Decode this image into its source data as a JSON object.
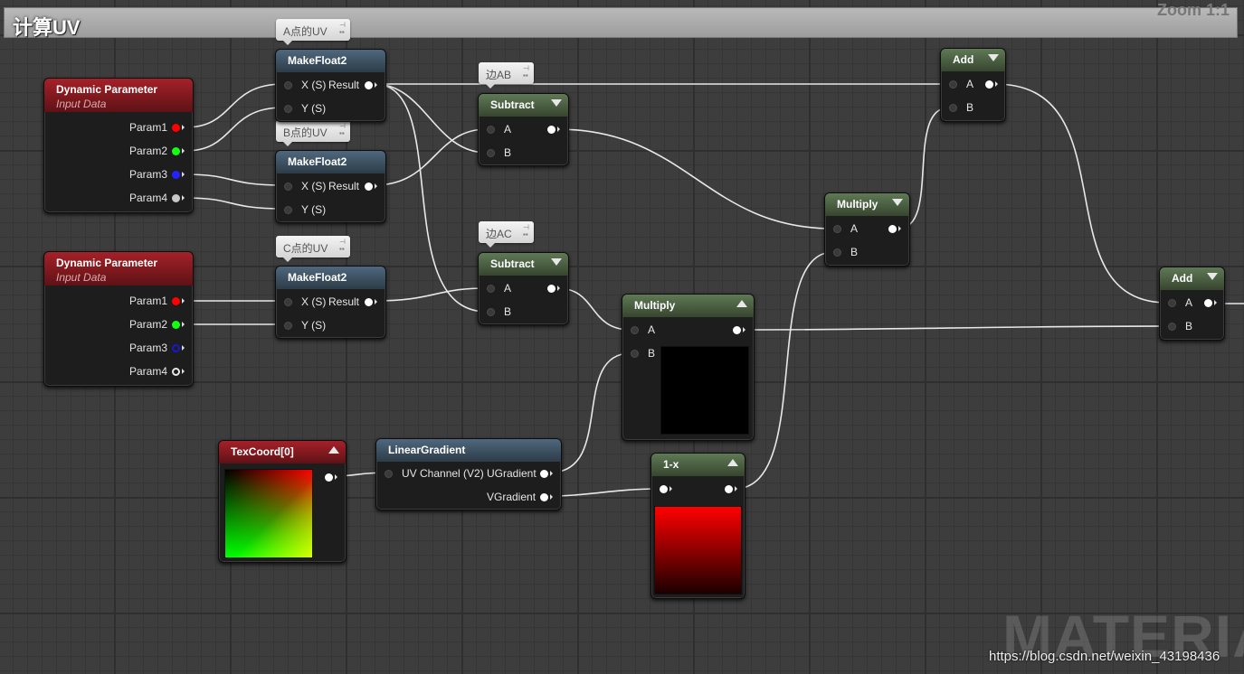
{
  "graph": {
    "comment_title": "计算UV",
    "zoom_label": "Zoom 1:1",
    "watermark": "MATERIAL",
    "url": "https://blog.csdn.net/weixin_43198436"
  },
  "comments": {
    "a_uv": "A点的UV",
    "b_uv": "B点的UV",
    "c_uv": "C点的UV",
    "edge_ab": "边AB",
    "edge_ac": "边AC"
  },
  "nodes": {
    "dyn1": {
      "title": "Dynamic Parameter",
      "subtitle": "Input Data",
      "params": [
        "Param1",
        "Param2",
        "Param3",
        "Param4"
      ]
    },
    "dyn2": {
      "title": "Dynamic Parameter",
      "subtitle": "Input Data",
      "params": [
        "Param1",
        "Param2",
        "Param3",
        "Param4"
      ]
    },
    "mf_a": {
      "title": "MakeFloat2",
      "in_x": "X (S)",
      "out": "Result",
      "in_y": "Y (S)"
    },
    "mf_b": {
      "title": "MakeFloat2",
      "in_x": "X (S)",
      "out": "Result",
      "in_y": "Y (S)"
    },
    "mf_c": {
      "title": "MakeFloat2",
      "in_x": "X (S)",
      "out": "Result",
      "in_y": "Y (S)"
    },
    "sub_ab": {
      "title": "Subtract",
      "a": "A",
      "b": "B"
    },
    "sub_ac": {
      "title": "Subtract",
      "a": "A",
      "b": "B"
    },
    "mul1": {
      "title": "Multiply",
      "a": "A",
      "b": "B"
    },
    "mul2": {
      "title": "Multiply",
      "a": "A",
      "b": "B"
    },
    "add1": {
      "title": "Add",
      "a": "A",
      "b": "B"
    },
    "add2": {
      "title": "Add",
      "a": "A",
      "b": "B"
    },
    "texcoord": {
      "title": "TexCoord[0]"
    },
    "lingrad": {
      "title": "LinearGradient",
      "in": "UV Channel (V2)",
      "out_u": "UGradient",
      "out_v": "VGradient"
    },
    "oneminus": {
      "title": "1-x"
    }
  },
  "colors": {
    "param1": "#ff0000",
    "param2": "#13ff13",
    "param3": "#2323ff",
    "param4": "#c8c8c8",
    "wire": "#e8e8e8"
  }
}
